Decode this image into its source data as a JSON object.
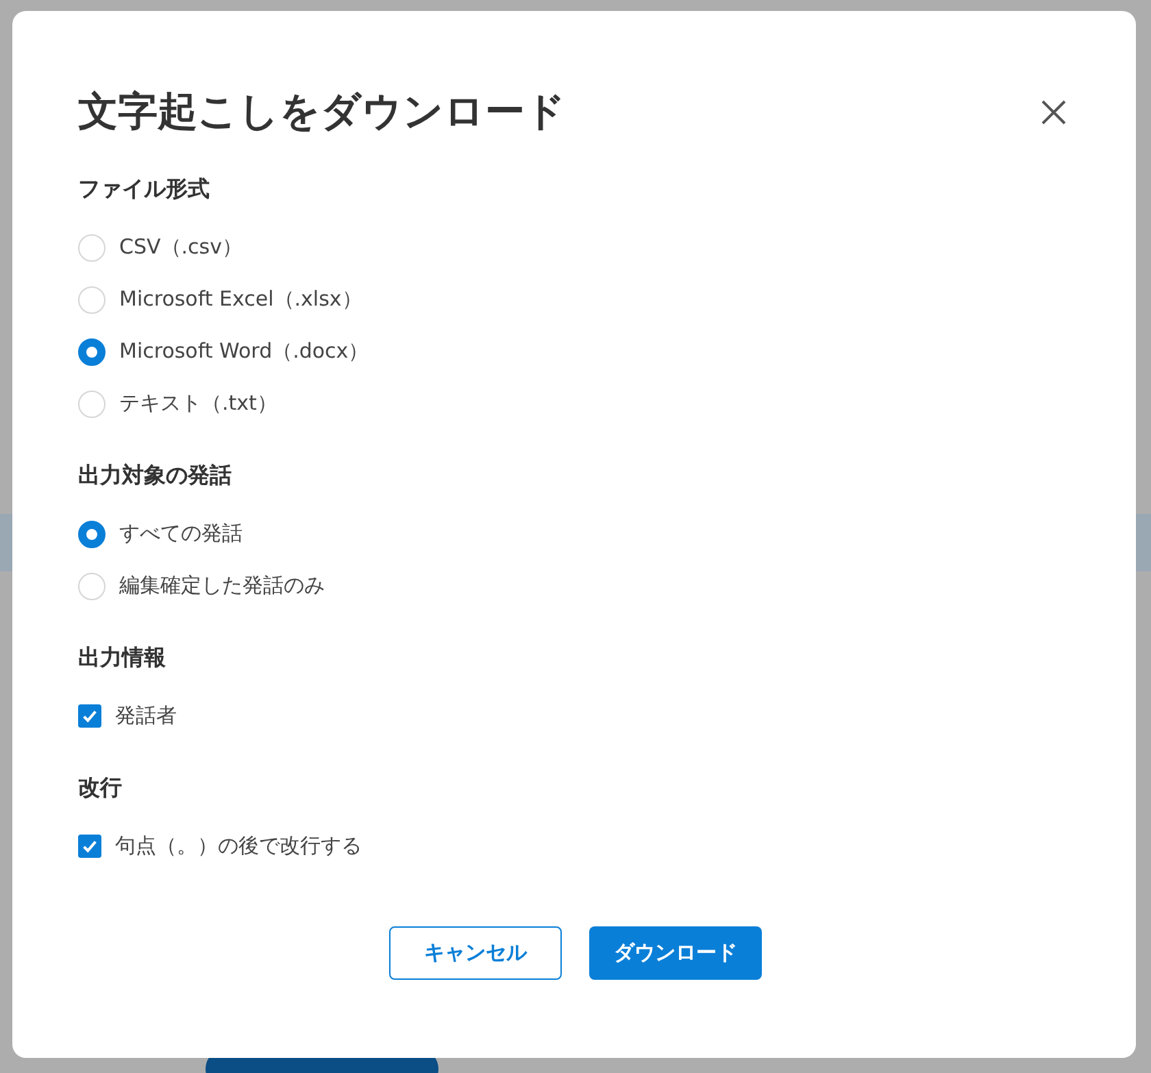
{
  "dialog": {
    "title": "文字起こしをダウンロード",
    "sections": [
      {
        "heading": "ファイル形式",
        "kind": "radio",
        "options": [
          {
            "label": "CSV（.csv）",
            "selected": false
          },
          {
            "label": "Microsoft Excel（.xlsx）",
            "selected": false
          },
          {
            "label": "Microsoft Word（.docx）",
            "selected": true
          },
          {
            "label": "テキスト（.txt）",
            "selected": false
          }
        ]
      },
      {
        "heading": "出力対象の発話",
        "kind": "radio",
        "options": [
          {
            "label": "すべての発話",
            "selected": true
          },
          {
            "label": "編集確定した発話のみ",
            "selected": false
          }
        ]
      },
      {
        "heading": "出力情報",
        "kind": "checkbox",
        "options": [
          {
            "label": "発話者",
            "checked": true
          }
        ]
      },
      {
        "heading": "改行",
        "kind": "checkbox",
        "options": [
          {
            "label": "句点（。）の後で改行する",
            "checked": true
          }
        ]
      }
    ],
    "buttons": [
      {
        "label": "キャンセル",
        "kind": "secondary"
      },
      {
        "label": "ダウンロード",
        "kind": "primary"
      }
    ]
  }
}
